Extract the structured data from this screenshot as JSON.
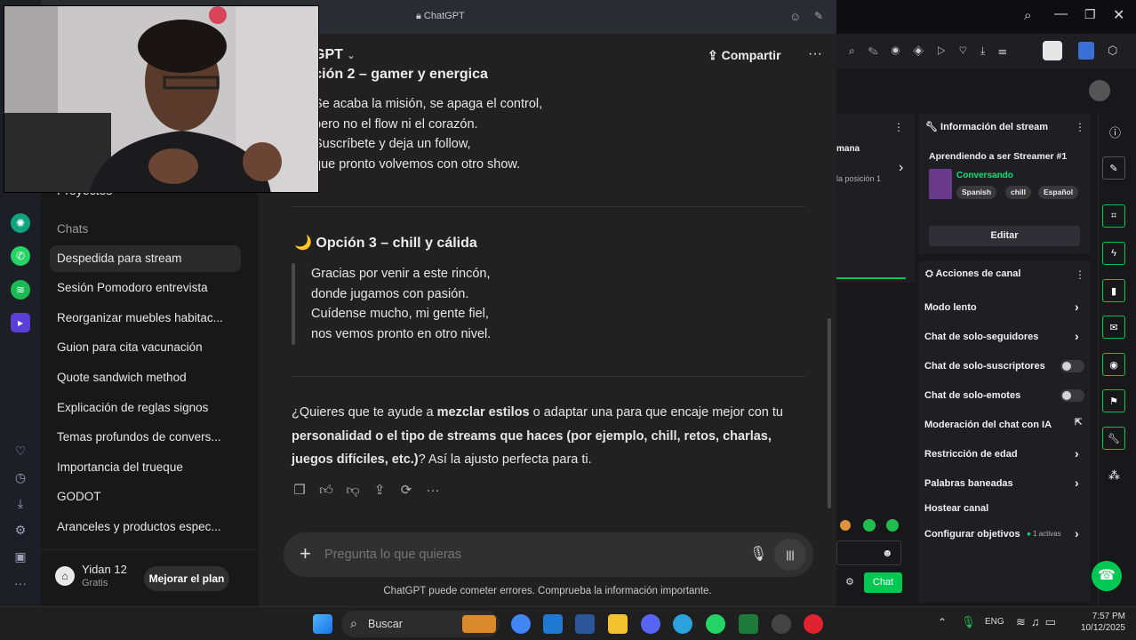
{
  "chatgpt": {
    "window_title": "ChatGPT",
    "model_label": "GPT",
    "share_label": "Compartir",
    "sidebar": {
      "projects_label": "Proyectos",
      "chats_label": "Chats",
      "items": [
        {
          "label": "Despedida para stream",
          "active": true
        },
        {
          "label": "Sesión Pomodoro entrevista"
        },
        {
          "label": "Reorganizar muebles habitac..."
        },
        {
          "label": "Guion para cita vacunación"
        },
        {
          "label": "Quote sandwich method"
        },
        {
          "label": "Explicación de reglas signos"
        },
        {
          "label": "Temas profundos de convers..."
        },
        {
          "label": "Importancia del trueque"
        },
        {
          "label": "GODOT"
        },
        {
          "label": "Aranceles y productos espec..."
        }
      ],
      "user_name": "Yidan 12",
      "user_plan": "Gratis",
      "upgrade_label": "Mejorar el plan"
    },
    "option2": {
      "heading": "Opción 2 – gamer y energica",
      "lines": [
        "Se acaba la misión, se apaga el control,",
        "pero no el flow ni el corazón.",
        "Suscríbete y deja un follow,",
        "que pronto volvemos con otro show."
      ]
    },
    "option3": {
      "emoji": "🌙",
      "heading": "Opción 3 – chill y cálida",
      "lines": [
        "Gracias por venir a este rincón,",
        "donde jugamos con pasión.",
        "Cuídense mucho, mi gente fiel,",
        "nos vemos pronto en otro nivel."
      ]
    },
    "closing": {
      "p1": "¿Quieres que te ayude a ",
      "b1": "mezclar estilos",
      "p2": " o adaptar una para que encaje mejor con tu ",
      "b2": "personalidad o el tipo de streams que haces (por ejemplo, chill, retos, charlas, juegos difíciles, etc.)",
      "p3": "? Así la ajusto perfecta para ti."
    },
    "input_placeholder": "Pregunta lo que quieras",
    "disclaimer": "ChatGPT puede cometer errores. Comprueba la información importante."
  },
  "twitch": {
    "stream_info_title": "Información del stream",
    "stream_title": "Aprendiendo a ser Streamer #1",
    "category": "Conversando",
    "tags": [
      "Spanish",
      "chill",
      "Español"
    ],
    "edit_label": "Editar",
    "left_partial_1": "mana",
    "left_partial_2": "la posición 1",
    "channel_actions_title": "Acciones de canal",
    "actions": [
      {
        "label": "Modo lento",
        "control": "chevron"
      },
      {
        "label": "Chat de solo-seguidores",
        "control": "chevron"
      },
      {
        "label": "Chat de solo-suscriptores",
        "control": "toggle"
      },
      {
        "label": "Chat de solo-emotes",
        "control": "toggle"
      },
      {
        "label": "Moderación del chat con IA",
        "control": "external"
      },
      {
        "label": "Restricción de edad",
        "control": "chevron"
      },
      {
        "label": "Palabras baneadas",
        "control": "chevron"
      },
      {
        "label": "Hostear canal",
        "control": "none"
      },
      {
        "label": "Configurar objetivos",
        "control": "chevron",
        "badge": "1 activas"
      }
    ],
    "chat_button": "Chat"
  },
  "taskbar": {
    "search_label": "Buscar",
    "lang": "ENG",
    "time": "7:57 PM",
    "date": "10/12/2025"
  },
  "colors": {
    "twitch_green": "#00c853",
    "chat_bg": "#212121",
    "sidebar_bg": "#181818"
  }
}
